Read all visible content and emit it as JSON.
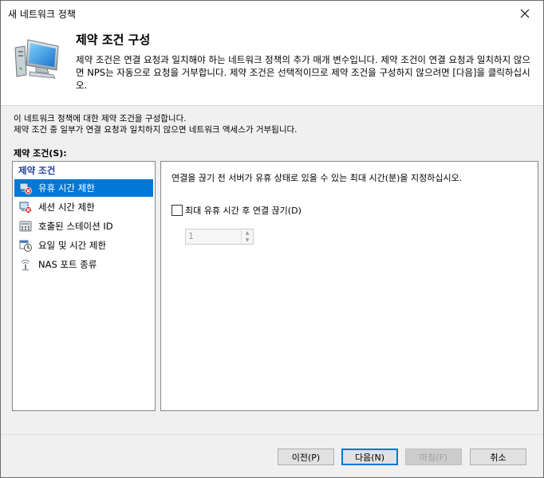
{
  "window": {
    "title": "새 네트워크 정책"
  },
  "header": {
    "title": "제약 조건 구성",
    "description": "제약 조건은 연결 요청과 일치해야 하는 네트워크 정책의 추가 매개 변수입니다. 제약 조건이 연결 요청과 일치하지 않으면 NPS는 자동으로 요청을 거부합니다. 제약 조건은 선택적이므로 제약 조건을 구성하지 않으려면 [다음]을 클릭하십시오."
  },
  "intro": {
    "line1": "이 네트워크 정책에 대한 제약 조건을 구성합니다.",
    "line2": "제약 조건 중 일부가 연결 요청과 일치하지 않으면 네트워크 액세스가 거부됩니다."
  },
  "constraints": {
    "label": "제약 조건(S):",
    "list_header": "제약 조건",
    "items": [
      {
        "label": "유휴 시간 제한",
        "icon": "idle-timeout-icon",
        "selected": true
      },
      {
        "label": "세션 시간 제한",
        "icon": "session-timeout-icon",
        "selected": false
      },
      {
        "label": "호출된 스테이션 ID",
        "icon": "called-station-icon",
        "selected": false
      },
      {
        "label": "요일 및 시간 제한",
        "icon": "day-time-icon",
        "selected": false
      },
      {
        "label": "NAS 포트 종류",
        "icon": "nas-port-icon",
        "selected": false
      }
    ]
  },
  "detail": {
    "description": "연결을 끊기 전 서버가 유휴 상태로 있을 수 있는 최대 시간(분)을 지정하십시오.",
    "checkbox_label": "최대 유휴 시간 후 연결 끊기(D)",
    "checkbox_checked": false,
    "spinner_value": "1"
  },
  "buttons": {
    "back": "이전(P)",
    "next": "다음(N)",
    "finish": "마침(F)",
    "cancel": "취소"
  },
  "colors": {
    "selection": "#0078d7",
    "list_header": "#1f3b9a"
  }
}
